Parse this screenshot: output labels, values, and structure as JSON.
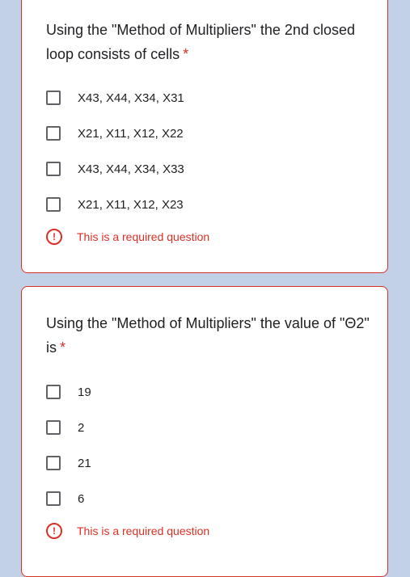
{
  "questions": [
    {
      "title": "Using the \"Method of Multipliers\" the 2nd closed loop consists of cells",
      "required_marker": "*",
      "options": [
        {
          "label": "X43, X44, X34, X31",
          "checked": false
        },
        {
          "label": "X21, X11, X12, X22",
          "checked": false
        },
        {
          "label": "X43, X44, X34, X33",
          "checked": false
        },
        {
          "label": "X21, X11, X12, X23",
          "checked": false
        }
      ],
      "error_icon": "!",
      "error_text": "This is a required question"
    },
    {
      "title": "Using the \"Method of Multipliers\" the value of \"Θ2\" is",
      "required_marker": "*",
      "options": [
        {
          "label": "19",
          "checked": false
        },
        {
          "label": "2",
          "checked": false
        },
        {
          "label": "21",
          "checked": false
        },
        {
          "label": "6",
          "checked": false
        }
      ],
      "error_icon": "!",
      "error_text": "This is a required question"
    }
  ],
  "colors": {
    "background": "#c2d1e6",
    "error": "#d93025",
    "text": "#202124",
    "checkbox_border": "#5f6368"
  }
}
